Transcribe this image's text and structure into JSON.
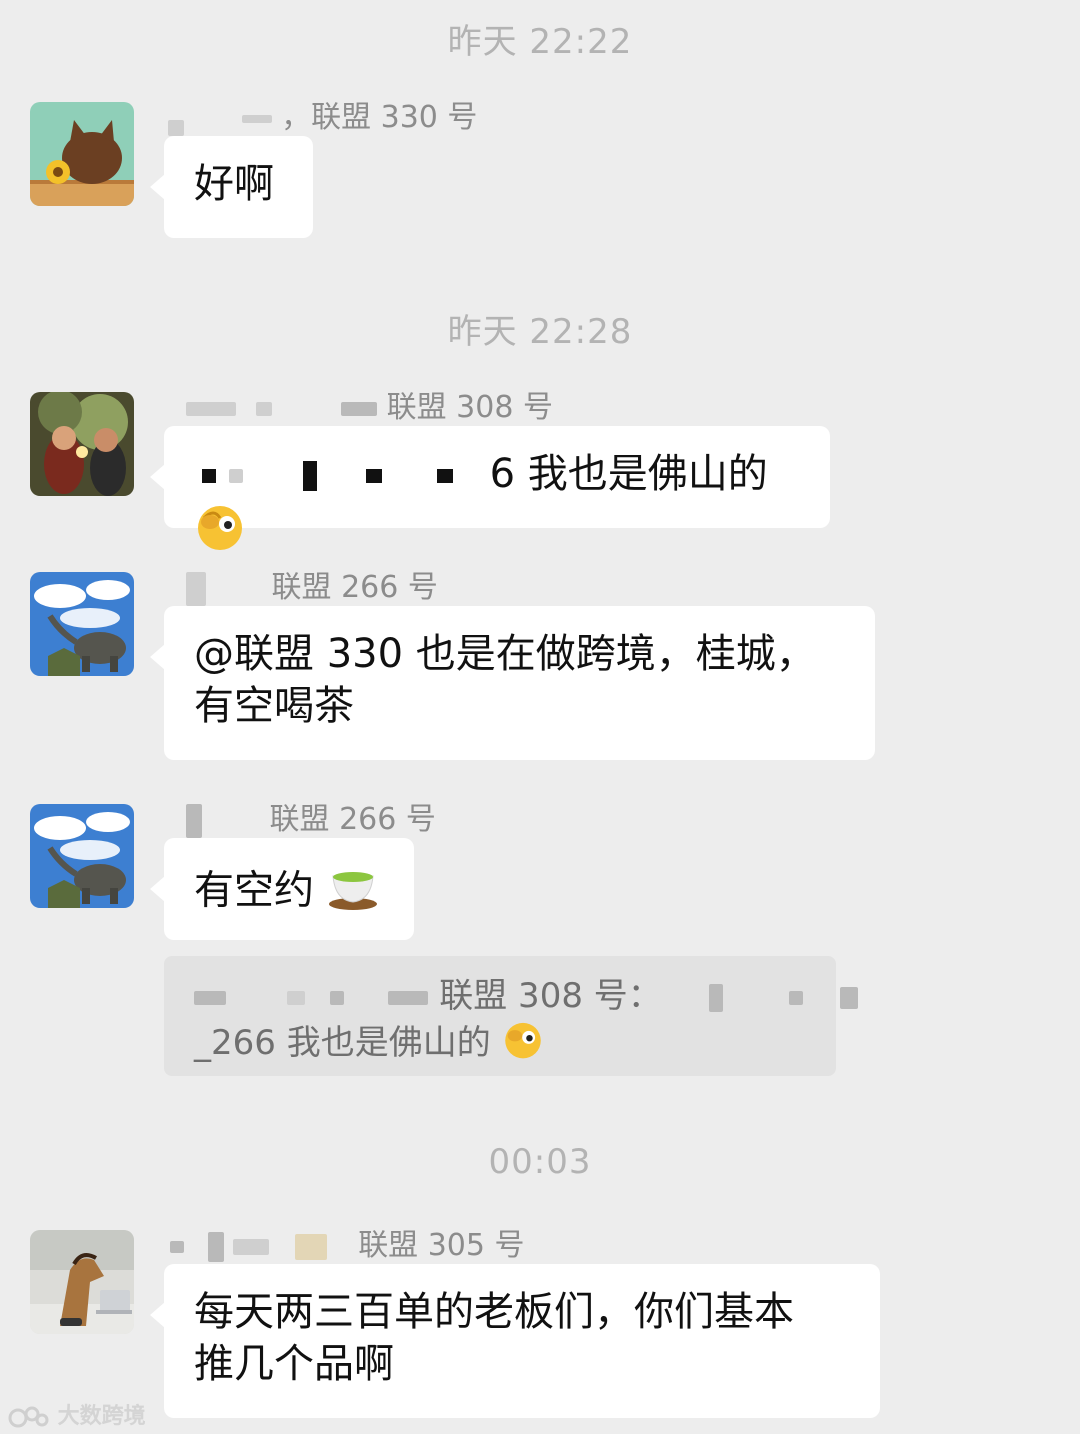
{
  "timestamps": [
    "昨天 22:22",
    "昨天 22:28",
    "00:03"
  ],
  "messages": [
    {
      "sender": "，联盟 330 号",
      "text": "好啊"
    },
    {
      "sender": "联盟 308 号",
      "text": "6 我也是佛山的"
    },
    {
      "sender": "联盟 266 号",
      "text_line1": "@联盟 330 也是在做跨境，桂城，",
      "text_line2": "有空喝茶"
    },
    {
      "sender": "联盟 266 号",
      "text": "有空约"
    },
    {
      "sender": "联盟 305 号",
      "text_line1": "每天两三百单的老板们，你们基本",
      "text_line2": "推几个品啊"
    }
  ],
  "quote": {
    "line1": "联盟 308 号：",
    "line2": "_266 我也是佛山的"
  },
  "emojis": [
    "eye-wink-emoji",
    "tea-cup-emoji"
  ],
  "watermark": "大数跨境"
}
